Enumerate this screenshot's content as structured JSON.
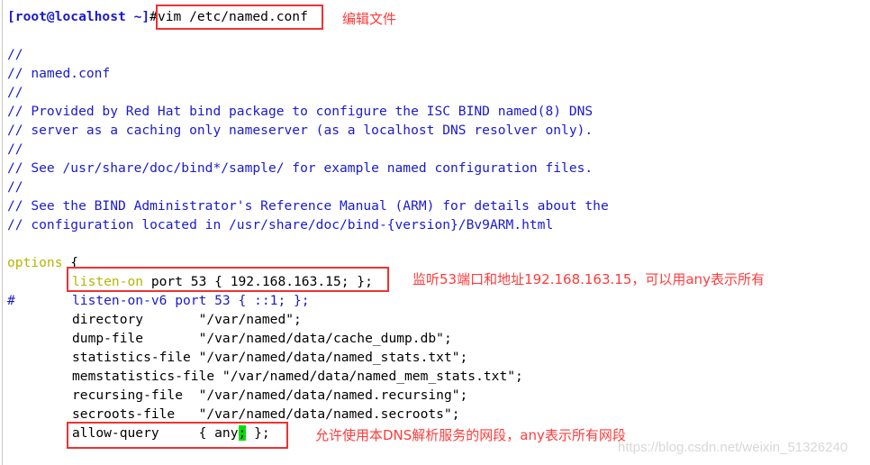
{
  "terminal": {
    "prompt": "[root@localhost ~]",
    "command": "#vim /etc/named.conf",
    "lines": [
      {
        "type": "comment",
        "text": "//"
      },
      {
        "type": "comment",
        "text": "// named.conf"
      },
      {
        "type": "comment",
        "text": "//"
      },
      {
        "type": "comment",
        "text": "// Provided by Red Hat bind package to configure the ISC BIND named(8) DNS"
      },
      {
        "type": "comment",
        "text": "// server as a caching only nameserver (as a localhost DNS resolver only)."
      },
      {
        "type": "comment",
        "text": "//"
      },
      {
        "type": "comment",
        "text": "// See /usr/share/doc/bind*/sample/ for example named configuration files."
      },
      {
        "type": "comment",
        "text": "//"
      },
      {
        "type": "comment",
        "text": "// See the BIND Administrator's Reference Manual (ARM) for details about the"
      },
      {
        "type": "comment",
        "text": "// configuration located in /usr/share/doc/bind-{version}/Bv9ARM.html"
      }
    ],
    "options_kw": "options",
    "options_brace": " {",
    "listen_kw": "listen-on",
    "listen_rest": " port 53 { 192.168.163.15; };",
    "hash": "#",
    "listen_v6": "listen-on-v6 port 53 { ::1; };",
    "body": [
      "directory       \"/var/named\";",
      "dump-file       \"/var/named/data/cache_dump.db\";",
      "statistics-file \"/var/named/data/named_stats.txt\";",
      "memstatistics-file \"/var/named/data/named_mem_stats.txt\";",
      "recursing-file  \"/var/named/data/named.recursing\";",
      "secroots-file   \"/var/named/data/named.secroots\";"
    ],
    "allow_pre": "allow-query     { any",
    "allow_cursor": ";",
    "allow_post": " };",
    "last": "//"
  },
  "annotations": {
    "edit": "编辑文件",
    "listen": "监听53端口和地址192.168.163.15，可以用any表示所有",
    "allow": "允许使用本DNS解析服务的网段，any表示所有网段"
  },
  "watermark": "https://blog.csdn.net/weixin_51326240",
  "colors": {
    "comment": "#1a1ad0",
    "keyword": "#b5b500",
    "annotation": "#ff3b3b",
    "cursor": "#00e000"
  }
}
